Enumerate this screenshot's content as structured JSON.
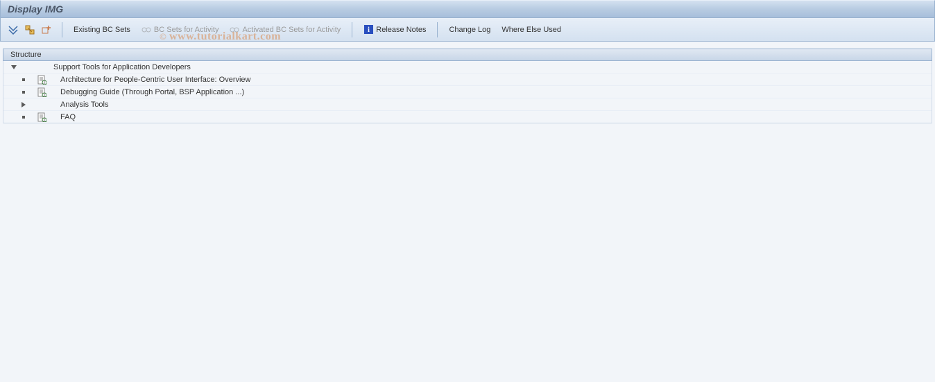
{
  "title": "Display IMG",
  "toolbar": {
    "existing_bc_sets": "Existing BC Sets",
    "bc_sets_for_activity": "BC Sets for Activity",
    "activated_bc_sets_for_activity": "Activated BC Sets for Activity",
    "release_notes": "Release Notes",
    "change_log": "Change Log",
    "where_else_used": "Where Else Used"
  },
  "structure_header": "Structure",
  "tree": {
    "root": {
      "label": "Support Tools for Application Developers",
      "expanded": true
    },
    "items": [
      {
        "label": "Architecture for People-Centric User Interface: Overview",
        "has_doc": true,
        "expandable": false
      },
      {
        "label": "Debugging Guide (Through Portal, BSP Application ...)",
        "has_doc": true,
        "expandable": false
      },
      {
        "label": "Analysis Tools",
        "has_doc": false,
        "expandable": true
      },
      {
        "label": "FAQ",
        "has_doc": true,
        "expandable": false
      }
    ]
  },
  "watermark": "www.tutorialkart.com"
}
